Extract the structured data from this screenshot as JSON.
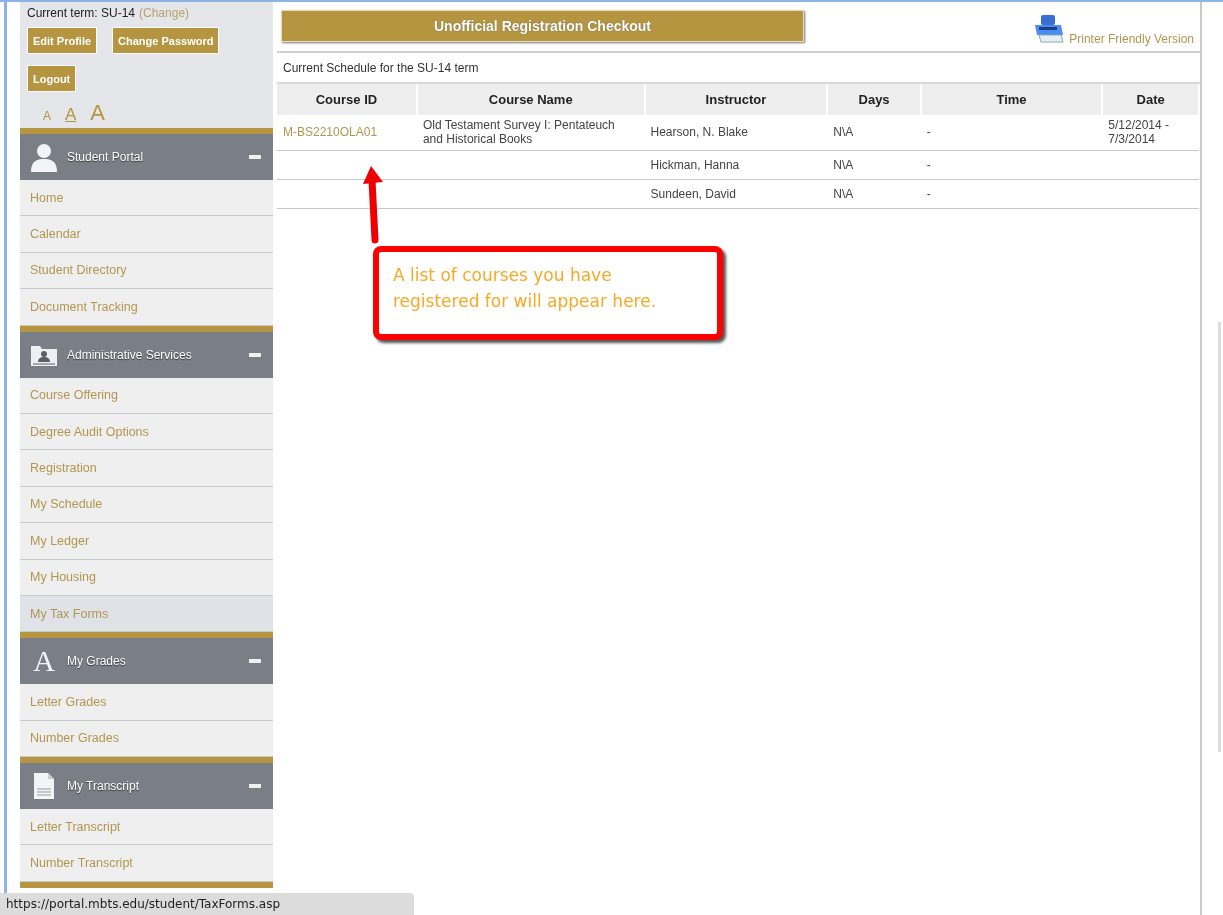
{
  "account": {
    "term_label": "Current term: SU-14",
    "change_link": "(Change)",
    "buttons": [
      "Edit Profile",
      "Change Password",
      "Logout"
    ],
    "font_sizes": [
      {
        "label": "A",
        "selected": false
      },
      {
        "label": "A",
        "selected": true
      },
      {
        "label": "A",
        "selected": false
      }
    ]
  },
  "sidebar": {
    "sections": [
      {
        "title": "Student Portal",
        "kind": "person",
        "expanded": true,
        "items": [
          {
            "label": "Home",
            "selected": false
          },
          {
            "label": "Calendar",
            "selected": false
          },
          {
            "label": "Student Directory",
            "selected": false
          },
          {
            "label": "Document Tracking",
            "selected": false
          }
        ]
      },
      {
        "title": "Administrative Services",
        "kind": "folder",
        "expanded": true,
        "items": [
          {
            "label": "Course Offering",
            "selected": false
          },
          {
            "label": "Degree Audit Options",
            "selected": false
          },
          {
            "label": "Registration",
            "selected": false
          },
          {
            "label": "My Schedule",
            "selected": false
          },
          {
            "label": "My Ledger",
            "selected": false
          },
          {
            "label": "My Housing",
            "selected": false
          },
          {
            "label": "My Tax Forms",
            "selected": true
          }
        ]
      },
      {
        "title": "My Grades",
        "kind": "glyph",
        "icon_text": "A",
        "expanded": true,
        "items": [
          {
            "label": "Letter Grades",
            "selected": false
          },
          {
            "label": "Number Grades",
            "selected": false
          }
        ]
      },
      {
        "title": "My Transcript",
        "kind": "document",
        "expanded": true,
        "items": [
          {
            "label": "Letter Transcript",
            "selected": false
          },
          {
            "label": "Number Transcript",
            "selected": false
          }
        ]
      }
    ]
  },
  "main": {
    "title": "Unofficial Registration Checkout",
    "printer_link": "Printer Friendly Version",
    "schedule_caption": "Current Schedule for the SU-14 term",
    "table": {
      "columns": [
        "Course ID",
        "Course Name",
        "Instructor",
        "Days",
        "Time",
        "Date"
      ],
      "rows": [
        {
          "course_id": "M-BS2210OLA01",
          "course_name": "Old Testament Survey I: Pentateuch and Historical Books",
          "instructor": "Hearson, N. Blake",
          "days": "N\\A",
          "time": "-",
          "date": "5/12/2014 - 7/3/2014"
        },
        {
          "instructor": "Hickman, Hanna",
          "days": "N\\A",
          "time": "-"
        },
        {
          "instructor": "Sundeen, David",
          "days": "N\\A",
          "time": "-"
        }
      ]
    },
    "callout": {
      "text": "A list of courses you have registered for will appear here."
    }
  },
  "status_bar": {
    "url": "https://portal.mbts.edu/student/TaxForms.asp"
  }
}
